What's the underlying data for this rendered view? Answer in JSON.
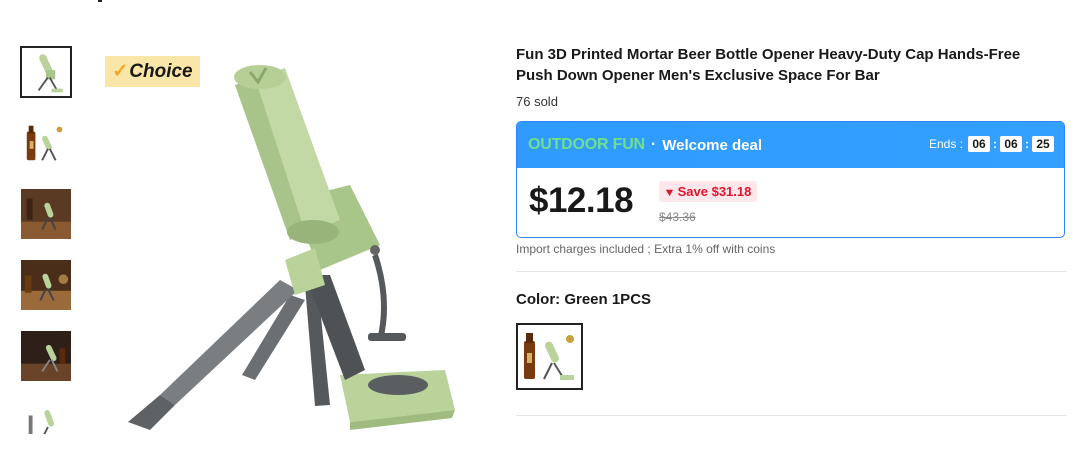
{
  "badge": {
    "icon": "check-icon",
    "check": "✓",
    "label": "Choice"
  },
  "thumbnails": [
    {
      "name": "thumb-product-green"
    },
    {
      "name": "thumb-product-with-beer"
    },
    {
      "name": "thumb-scene-bar"
    },
    {
      "name": "thumb-scene-table"
    },
    {
      "name": "thumb-scene-dark"
    },
    {
      "name": "thumb-product-partial"
    }
  ],
  "product": {
    "title": "Fun 3D Printed Mortar Beer Bottle Opener Heavy-Duty Cap Hands-Free Push Down Opener Men's Exclusive Space For Bar",
    "sold": "76 sold"
  },
  "deal": {
    "brand": "OUTDOOR FUN",
    "dot": "·",
    "label": "Welcome deal",
    "ends_label": "Ends :",
    "timer": [
      "06",
      "06",
      "25"
    ],
    "sep": ":",
    "price": "$12.18",
    "save_icon": "arrow-down-icon",
    "save": "Save $31.18",
    "original_price": "$43.36",
    "colors": {
      "banner": "#2f9bff",
      "brand": "#6fe08a",
      "save_text": "#e0142c",
      "save_bg": "#fde7ea"
    }
  },
  "import_note": "Import charges included ; Extra 1% off with coins",
  "color": {
    "label": "Color: Green 1PCS",
    "selected": "Green 1PCS"
  }
}
